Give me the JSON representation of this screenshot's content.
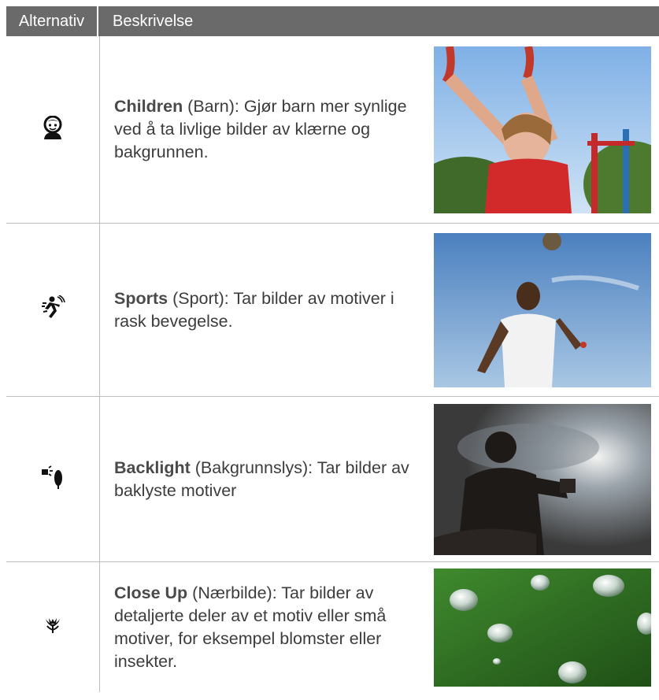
{
  "header": {
    "col1": "Alternativ",
    "col2": "Beskrivelse"
  },
  "rows": [
    {
      "icon": "children-mode-icon",
      "title": "Children",
      "rest": " (Barn): Gjør barn mer synlige ved å ta livlige bilder av klærne og bakgrunnen.",
      "photo": "photo-child-on-rings"
    },
    {
      "icon": "sports-mode-icon",
      "title": "Sports",
      "rest": " (Sport): Tar bilder av motiver i rask bevegelse.",
      "photo": "photo-soccer-header"
    },
    {
      "icon": "backlight-mode-icon",
      "title": "Backlight",
      "rest": " (Bakgrunnslys): Tar bilder av baklyste motiver",
      "photo": "photo-silhouette-photographer"
    },
    {
      "icon": "close-up-mode-icon",
      "title": "Close Up",
      "rest": " (Nærbilde): Tar bilder av detaljerte deler av et motiv eller små motiver, for eksempel blomster eller insekter.",
      "photo": "photo-water-drops-leaf"
    }
  ]
}
